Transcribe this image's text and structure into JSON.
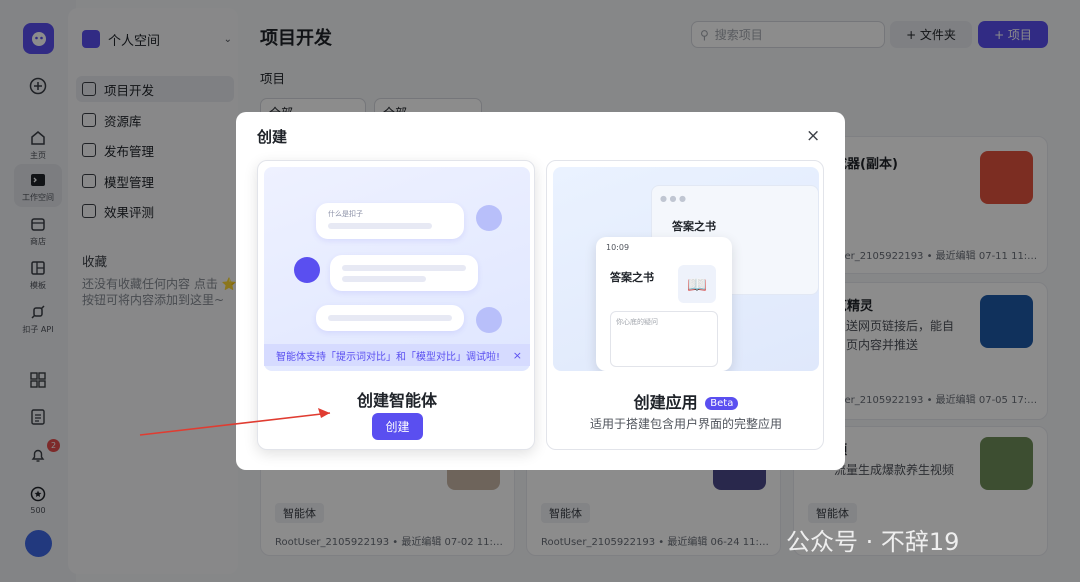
{
  "rail": {
    "items": [
      {
        "label": "主页",
        "icon": "home-icon"
      },
      {
        "label": "工作空间",
        "icon": "terminal-icon"
      },
      {
        "label": "商店",
        "icon": "store-icon"
      },
      {
        "label": "模板",
        "icon": "template-icon"
      },
      {
        "label": "扣子 API",
        "icon": "api-icon"
      }
    ],
    "notification_count": "2",
    "points": "500"
  },
  "sidebar": {
    "space_name": "个人空间",
    "items": [
      {
        "label": "项目开发"
      },
      {
        "label": "资源库"
      },
      {
        "label": "发布管理"
      },
      {
        "label": "模型管理"
      },
      {
        "label": "效果评测"
      }
    ],
    "favorites_title": "收藏",
    "favorites_empty": "还没有收藏任何内容 点击 ⭐ 按钮可将内容添加到这里~"
  },
  "main": {
    "title": "项目开发",
    "section_label": "项目",
    "search_placeholder": "搜索项目",
    "folder_button": "+ 文件夹",
    "project_button": "+ 项目",
    "filters": [
      "全部",
      "全部"
    ],
    "cards": [
      {
        "title": "成器(副本)",
        "author": "User_2105922193 • 最近编辑 07-11 11:…"
      },
      {
        "title": "览精灵",
        "desc": "发送网页链接后，能自 网页内容并推送",
        "author": "User_2105922193 • 最近编辑 07-05 17:…"
      },
      {
        "title": "频",
        "desc": "流量生成爆款养生视频",
        "author": ""
      },
      {
        "tag": "智能体",
        "author": "RootUser_2105922193 • 最近编辑 07-02 11:…"
      },
      {
        "tag": "智能体",
        "author": "RootUser_2105922193 • 最近编辑 06-24 11:…"
      },
      {
        "tag": "智能体",
        "author": "RootUser_2105922193 • 最近编辑 07-02 11:…"
      }
    ]
  },
  "modal": {
    "title": "创建",
    "close": "×",
    "agent": {
      "title": "创建智能体",
      "button": "创建",
      "bubble_question": "什么是扣子",
      "tip": "智能体支持「提示词对比」和「模型对比」调试啦!",
      "tip_close": "×"
    },
    "app": {
      "title": "创建应用",
      "badge": "Beta",
      "subtitle": "适用于搭建包含用户界面的完整应用",
      "browser_title": "答案之书",
      "phone_time": "10:09",
      "phone_title": "答案之书",
      "phone_input": "你心底的疑问"
    }
  },
  "watermark": "公众号 · 不辞19",
  "colors": {
    "accent": "#5a4ff0",
    "arrow": "#e03c31"
  }
}
